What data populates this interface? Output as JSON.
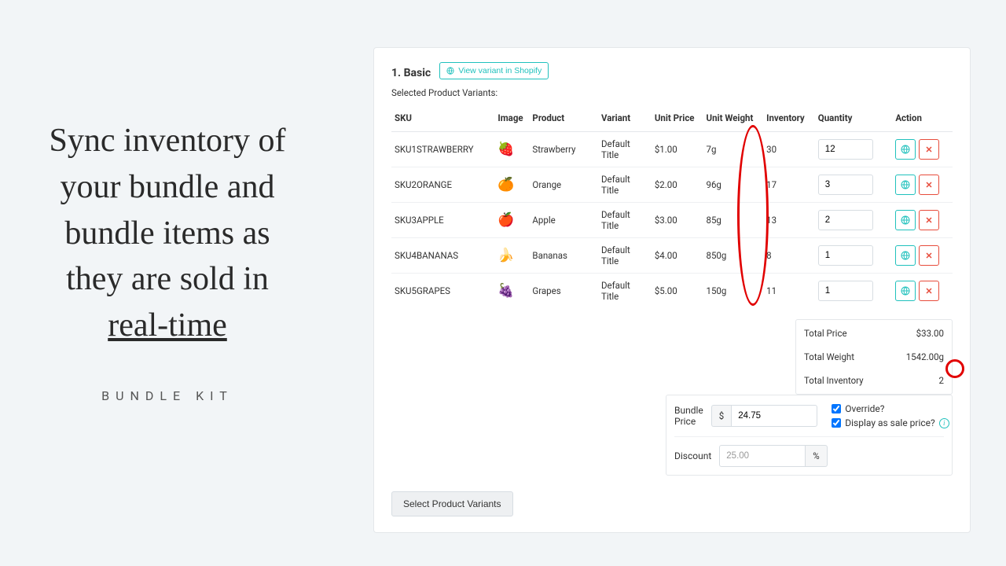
{
  "left": {
    "headline_lines": [
      "Sync inventory of",
      "your bundle and",
      "bundle items as",
      "they are sold in"
    ],
    "headline_underlined": "real-time",
    "brand": "BUNDLE KIT"
  },
  "panel": {
    "title": "1. Basic",
    "view_variant_label": "View variant in Shopify",
    "subhead": "Selected Product Variants:",
    "headers": {
      "sku": "SKU",
      "image": "Image",
      "product": "Product",
      "variant": "Variant",
      "unit_price": "Unit Price",
      "unit_weight": "Unit Weight",
      "inventory": "Inventory",
      "quantity": "Quantity",
      "action": "Action"
    },
    "rows": [
      {
        "sku": "SKU1STRAWBERRY",
        "emoji": "🍓",
        "product": "Strawberry",
        "variant": "Default Title",
        "unit_price": "$1.00",
        "unit_weight": "7g",
        "inventory": "30",
        "quantity": "12"
      },
      {
        "sku": "SKU2ORANGE",
        "emoji": "🍊",
        "product": "Orange",
        "variant": "Default Title",
        "unit_price": "$2.00",
        "unit_weight": "96g",
        "inventory": "17",
        "quantity": "3"
      },
      {
        "sku": "SKU3APPLE",
        "emoji": "🍎",
        "product": "Apple",
        "variant": "Default Title",
        "unit_price": "$3.00",
        "unit_weight": "85g",
        "inventory": "13",
        "quantity": "2"
      },
      {
        "sku": "SKU4BANANAS",
        "emoji": "🍌",
        "product": "Bananas",
        "variant": "Default Title",
        "unit_price": "$4.00",
        "unit_weight": "850g",
        "inventory": "8",
        "quantity": "1"
      },
      {
        "sku": "SKU5GRAPES",
        "emoji": "🍇",
        "product": "Grapes",
        "variant": "Default Title",
        "unit_price": "$5.00",
        "unit_weight": "150g",
        "inventory": "11",
        "quantity": "1"
      }
    ],
    "totals": {
      "price_label": "Total Price",
      "price_value": "$33.00",
      "weight_label": "Total Weight",
      "weight_value": "1542.00g",
      "inv_label": "Total Inventory",
      "inv_value": "2"
    },
    "pricing": {
      "bundle_price_label": "Bundle Price",
      "currency": "$",
      "bundle_price_value": "24.75",
      "override_label": "Override?",
      "display_sale_label": "Display as sale price?",
      "discount_label": "Discount",
      "discount_value": "25.00",
      "percent": "%"
    },
    "select_button": "Select Product Variants"
  }
}
